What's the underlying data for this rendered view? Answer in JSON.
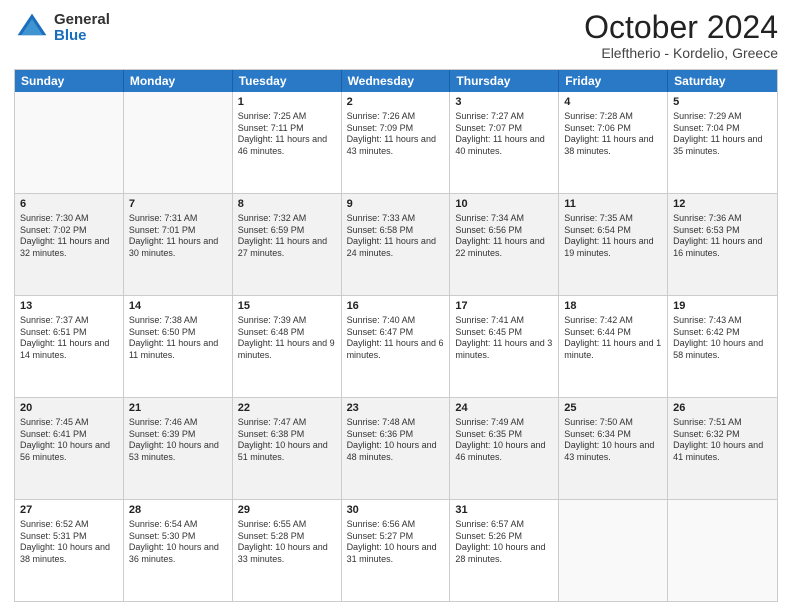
{
  "header": {
    "logo_general": "General",
    "logo_blue": "Blue",
    "title": "October 2024",
    "subtitle": "Eleftherio - Kordelio, Greece"
  },
  "days": [
    "Sunday",
    "Monday",
    "Tuesday",
    "Wednesday",
    "Thursday",
    "Friday",
    "Saturday"
  ],
  "weeks": [
    [
      {
        "day": "",
        "info": "",
        "empty": true
      },
      {
        "day": "",
        "info": "",
        "empty": true
      },
      {
        "day": "1",
        "info": "Sunrise: 7:25 AM\nSunset: 7:11 PM\nDaylight: 11 hours and 46 minutes."
      },
      {
        "day": "2",
        "info": "Sunrise: 7:26 AM\nSunset: 7:09 PM\nDaylight: 11 hours and 43 minutes."
      },
      {
        "day": "3",
        "info": "Sunrise: 7:27 AM\nSunset: 7:07 PM\nDaylight: 11 hours and 40 minutes."
      },
      {
        "day": "4",
        "info": "Sunrise: 7:28 AM\nSunset: 7:06 PM\nDaylight: 11 hours and 38 minutes."
      },
      {
        "day": "5",
        "info": "Sunrise: 7:29 AM\nSunset: 7:04 PM\nDaylight: 11 hours and 35 minutes."
      }
    ],
    [
      {
        "day": "6",
        "info": "Sunrise: 7:30 AM\nSunset: 7:02 PM\nDaylight: 11 hours and 32 minutes."
      },
      {
        "day": "7",
        "info": "Sunrise: 7:31 AM\nSunset: 7:01 PM\nDaylight: 11 hours and 30 minutes."
      },
      {
        "day": "8",
        "info": "Sunrise: 7:32 AM\nSunset: 6:59 PM\nDaylight: 11 hours and 27 minutes."
      },
      {
        "day": "9",
        "info": "Sunrise: 7:33 AM\nSunset: 6:58 PM\nDaylight: 11 hours and 24 minutes."
      },
      {
        "day": "10",
        "info": "Sunrise: 7:34 AM\nSunset: 6:56 PM\nDaylight: 11 hours and 22 minutes."
      },
      {
        "day": "11",
        "info": "Sunrise: 7:35 AM\nSunset: 6:54 PM\nDaylight: 11 hours and 19 minutes."
      },
      {
        "day": "12",
        "info": "Sunrise: 7:36 AM\nSunset: 6:53 PM\nDaylight: 11 hours and 16 minutes."
      }
    ],
    [
      {
        "day": "13",
        "info": "Sunrise: 7:37 AM\nSunset: 6:51 PM\nDaylight: 11 hours and 14 minutes."
      },
      {
        "day": "14",
        "info": "Sunrise: 7:38 AM\nSunset: 6:50 PM\nDaylight: 11 hours and 11 minutes."
      },
      {
        "day": "15",
        "info": "Sunrise: 7:39 AM\nSunset: 6:48 PM\nDaylight: 11 hours and 9 minutes."
      },
      {
        "day": "16",
        "info": "Sunrise: 7:40 AM\nSunset: 6:47 PM\nDaylight: 11 hours and 6 minutes."
      },
      {
        "day": "17",
        "info": "Sunrise: 7:41 AM\nSunset: 6:45 PM\nDaylight: 11 hours and 3 minutes."
      },
      {
        "day": "18",
        "info": "Sunrise: 7:42 AM\nSunset: 6:44 PM\nDaylight: 11 hours and 1 minute."
      },
      {
        "day": "19",
        "info": "Sunrise: 7:43 AM\nSunset: 6:42 PM\nDaylight: 10 hours and 58 minutes."
      }
    ],
    [
      {
        "day": "20",
        "info": "Sunrise: 7:45 AM\nSunset: 6:41 PM\nDaylight: 10 hours and 56 minutes."
      },
      {
        "day": "21",
        "info": "Sunrise: 7:46 AM\nSunset: 6:39 PM\nDaylight: 10 hours and 53 minutes."
      },
      {
        "day": "22",
        "info": "Sunrise: 7:47 AM\nSunset: 6:38 PM\nDaylight: 10 hours and 51 minutes."
      },
      {
        "day": "23",
        "info": "Sunrise: 7:48 AM\nSunset: 6:36 PM\nDaylight: 10 hours and 48 minutes."
      },
      {
        "day": "24",
        "info": "Sunrise: 7:49 AM\nSunset: 6:35 PM\nDaylight: 10 hours and 46 minutes."
      },
      {
        "day": "25",
        "info": "Sunrise: 7:50 AM\nSunset: 6:34 PM\nDaylight: 10 hours and 43 minutes."
      },
      {
        "day": "26",
        "info": "Sunrise: 7:51 AM\nSunset: 6:32 PM\nDaylight: 10 hours and 41 minutes."
      }
    ],
    [
      {
        "day": "27",
        "info": "Sunrise: 6:52 AM\nSunset: 5:31 PM\nDaylight: 10 hours and 38 minutes."
      },
      {
        "day": "28",
        "info": "Sunrise: 6:54 AM\nSunset: 5:30 PM\nDaylight: 10 hours and 36 minutes."
      },
      {
        "day": "29",
        "info": "Sunrise: 6:55 AM\nSunset: 5:28 PM\nDaylight: 10 hours and 33 minutes."
      },
      {
        "day": "30",
        "info": "Sunrise: 6:56 AM\nSunset: 5:27 PM\nDaylight: 10 hours and 31 minutes."
      },
      {
        "day": "31",
        "info": "Sunrise: 6:57 AM\nSunset: 5:26 PM\nDaylight: 10 hours and 28 minutes."
      },
      {
        "day": "",
        "info": "",
        "empty": true
      },
      {
        "day": "",
        "info": "",
        "empty": true
      }
    ]
  ]
}
